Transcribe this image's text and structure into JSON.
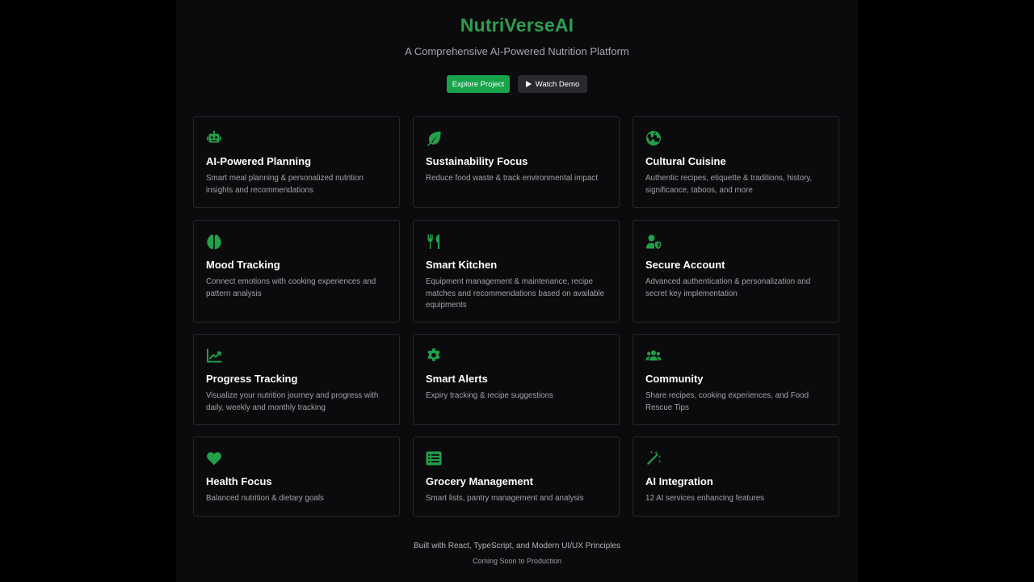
{
  "hero": {
    "title": "NutriVerseAI",
    "subtitle": "A Comprehensive AI-Powered Nutrition Platform",
    "primary_button": "Explore Project",
    "secondary_button": "Watch Demo"
  },
  "colors": {
    "accent": "#22a04a",
    "title": "#2e9e4f",
    "primary_button": "#17a34a",
    "background": "#0b0b0d",
    "card_border": "#27272b"
  },
  "features": [
    {
      "icon": "robot-icon",
      "title": "AI-Powered Planning",
      "description": "Smart meal planning & personalized nutrition insights and recommendations"
    },
    {
      "icon": "leaf-icon",
      "title": "Sustainability Focus",
      "description": "Reduce food waste & track environmental impact"
    },
    {
      "icon": "globe-icon",
      "title": "Cultural Cuisine",
      "description": "Authentic recipes, etiquette & traditions, history, significance, taboos, and more"
    },
    {
      "icon": "brain-icon",
      "title": "Mood Tracking",
      "description": "Connect emotions with cooking experiences and pattern analysis"
    },
    {
      "icon": "utensils-icon",
      "title": "Smart Kitchen",
      "description": "Equipment management & maintenance, recipe matches and recommendations based on available equipments"
    },
    {
      "icon": "user-shield-icon",
      "title": "Secure Account",
      "description": "Advanced authentication & personalization and secret key implementation"
    },
    {
      "icon": "chart-line-icon",
      "title": "Progress Tracking",
      "description": "Visualize your nutrition journey and progress with daily, weekly and monthly tracking"
    },
    {
      "icon": "gear-icon",
      "title": "Smart Alerts",
      "description": "Expiry tracking & recipe suggestions"
    },
    {
      "icon": "users-icon",
      "title": "Community",
      "description": "Share recipes, cooking experiences, and Food Rescue Tips"
    },
    {
      "icon": "heart-icon",
      "title": "Health Focus",
      "description": "Balanced nutrition & dietary goals"
    },
    {
      "icon": "list-icon",
      "title": "Grocery Management",
      "description": "Smart lists, pantry management and analysis"
    },
    {
      "icon": "magic-wand-icon",
      "title": "AI Integration",
      "description": "12 AI services enhancing features"
    }
  ],
  "footer": {
    "built_with": "Built with React, TypeScript, and Modern UI/UX Principles",
    "status": "Coming Soon to Production"
  }
}
